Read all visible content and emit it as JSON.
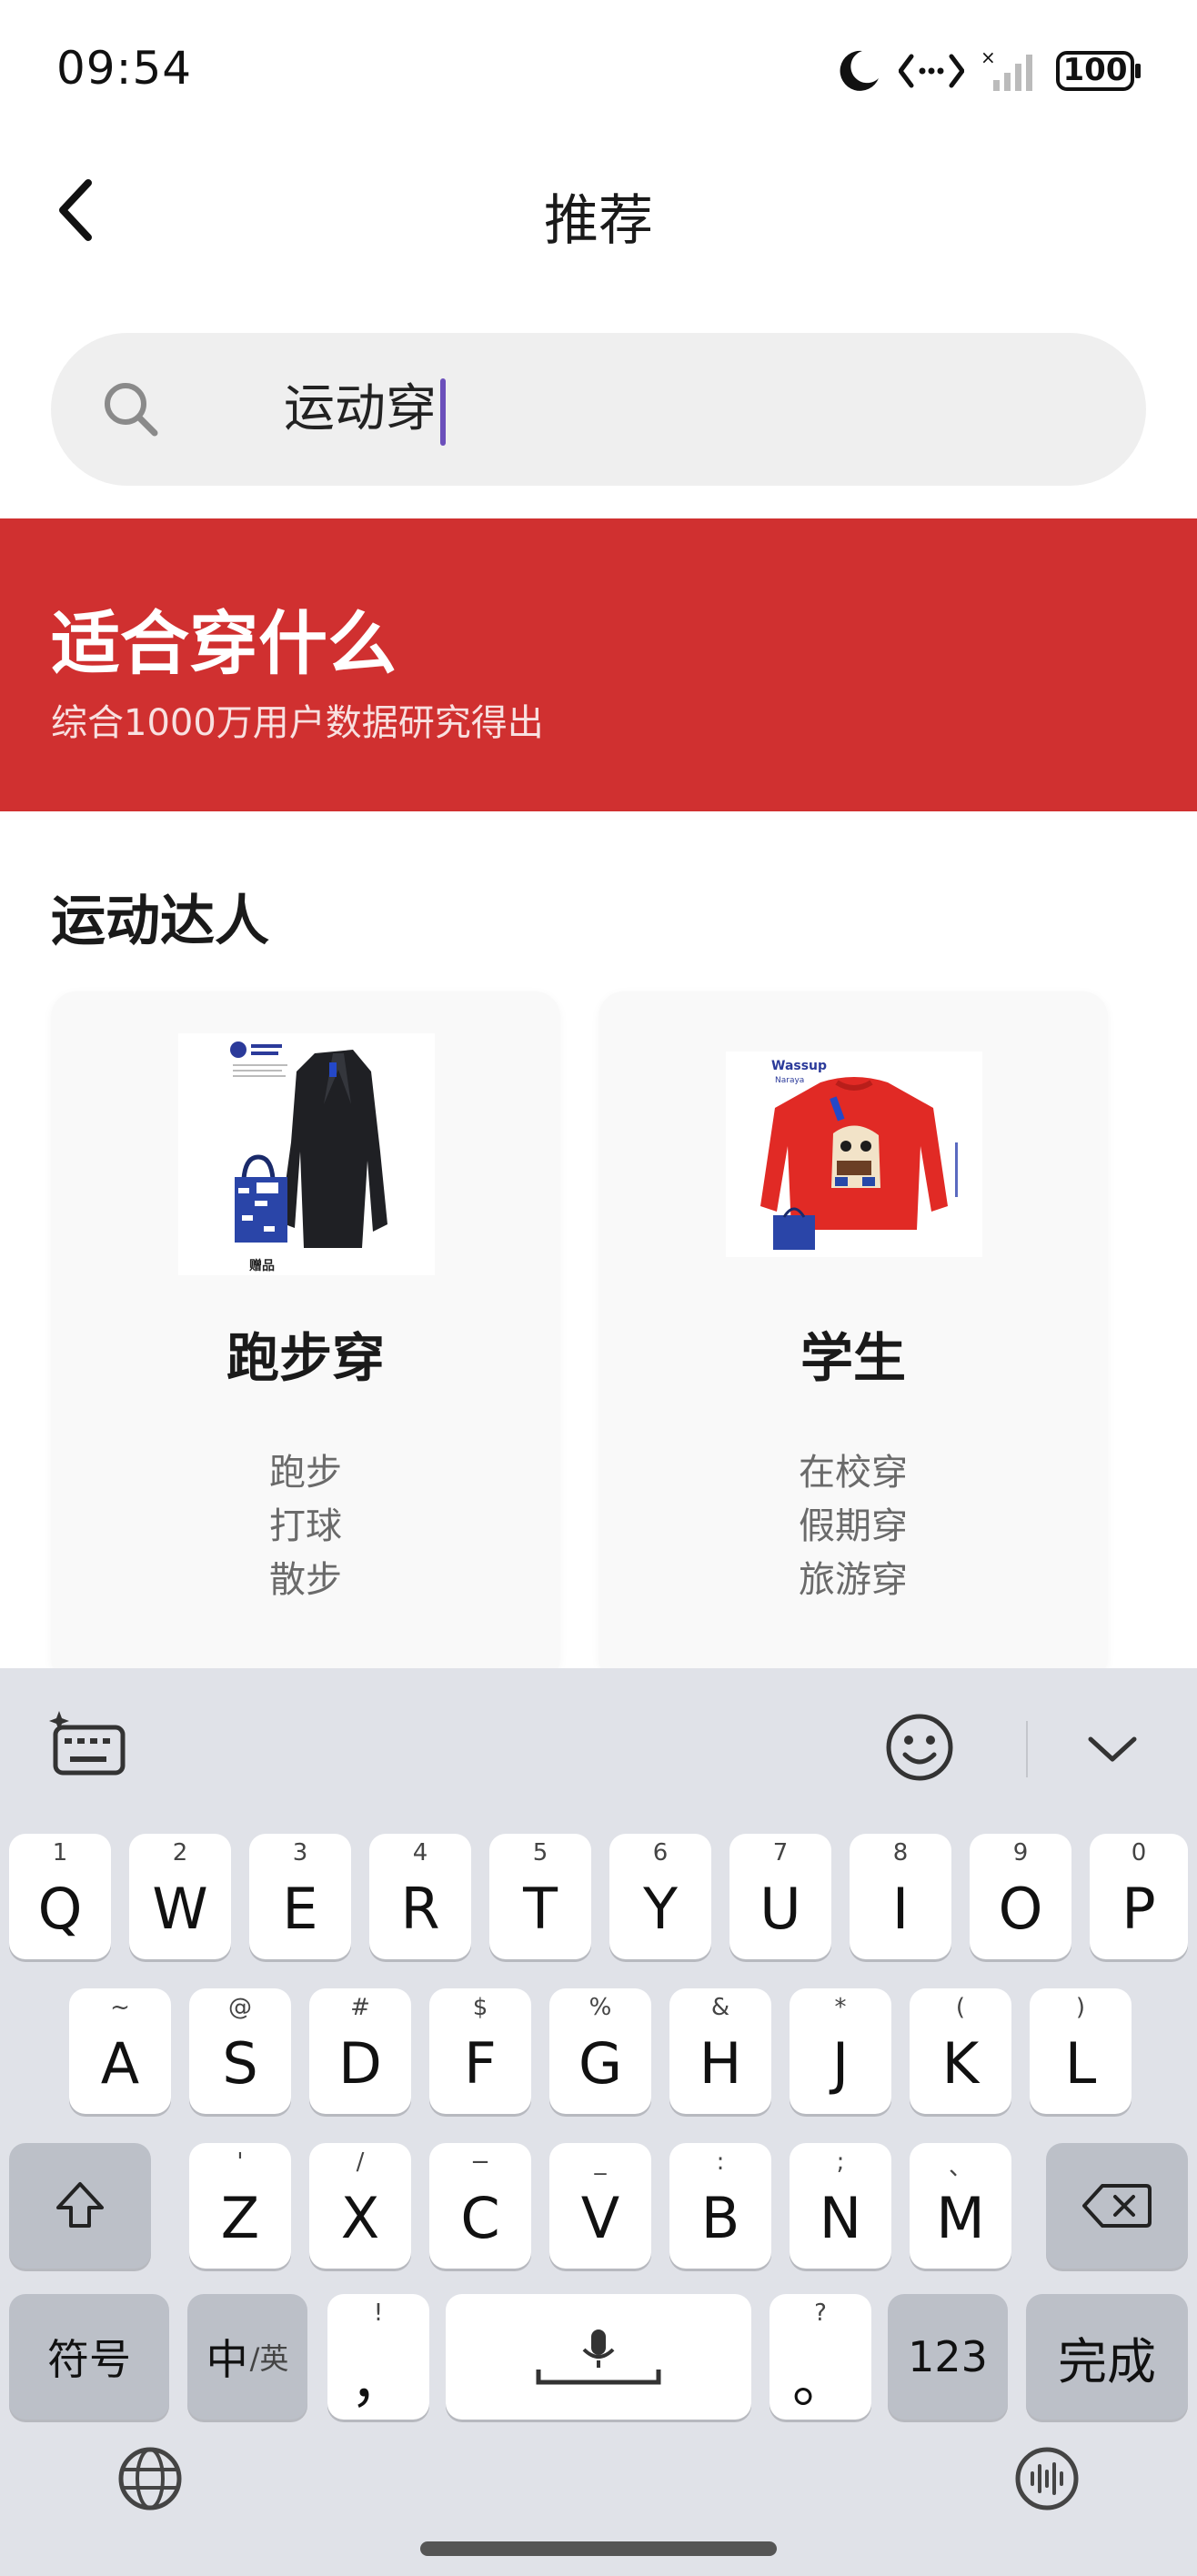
{
  "status_bar": {
    "time": "09:54",
    "battery": "100",
    "icons": [
      "moon-icon",
      "data-transfer-icon",
      "signal-icon",
      "battery-icon"
    ]
  },
  "nav": {
    "title": "推荐",
    "back_icon": "chevron-left-icon"
  },
  "search": {
    "query": "运动穿",
    "icon": "search-icon"
  },
  "banner": {
    "title": "适合穿什么",
    "subtitle": "综合1000万用户数据研究得出",
    "color": "#d03030"
  },
  "section": {
    "title": "运动达人",
    "cards": [
      {
        "name": "跑步穿",
        "tags": [
          "跑步",
          "打球",
          "散步"
        ],
        "image_caption": "赠品"
      },
      {
        "name": "学生",
        "tags": [
          "在校穿",
          "假期穿",
          "旅游穿"
        ],
        "image_caption": "Wassup"
      }
    ]
  },
  "keyboard": {
    "row1": [
      {
        "hint": "1",
        "key": "Q"
      },
      {
        "hint": "2",
        "key": "W"
      },
      {
        "hint": "3",
        "key": "E"
      },
      {
        "hint": "4",
        "key": "R"
      },
      {
        "hint": "5",
        "key": "T"
      },
      {
        "hint": "6",
        "key": "Y"
      },
      {
        "hint": "7",
        "key": "U"
      },
      {
        "hint": "8",
        "key": "I"
      },
      {
        "hint": "9",
        "key": "O"
      },
      {
        "hint": "0",
        "key": "P"
      }
    ],
    "row2": [
      {
        "hint": "~",
        "key": "A"
      },
      {
        "hint": "@",
        "key": "S"
      },
      {
        "hint": "#",
        "key": "D"
      },
      {
        "hint": "$",
        "key": "F"
      },
      {
        "hint": "%",
        "key": "G"
      },
      {
        "hint": "&",
        "key": "H"
      },
      {
        "hint": "*",
        "key": "J"
      },
      {
        "hint": "(",
        "key": "K"
      },
      {
        "hint": ")",
        "key": "L"
      }
    ],
    "row3": [
      {
        "hint": "'",
        "key": "Z"
      },
      {
        "hint": "/",
        "key": "X"
      },
      {
        "hint": "−",
        "key": "C"
      },
      {
        "hint": "_",
        "key": "V"
      },
      {
        "hint": ":",
        "key": "B"
      },
      {
        "hint": ";",
        "key": "N"
      },
      {
        "hint": "、",
        "key": "M"
      }
    ],
    "symbols_label": "符号",
    "lang_main": "中",
    "lang_alt": "/英",
    "comma_hint": "!",
    "comma": "，",
    "period_hint": "?",
    "period": "。",
    "num_label": "123",
    "done_label": "完成"
  }
}
